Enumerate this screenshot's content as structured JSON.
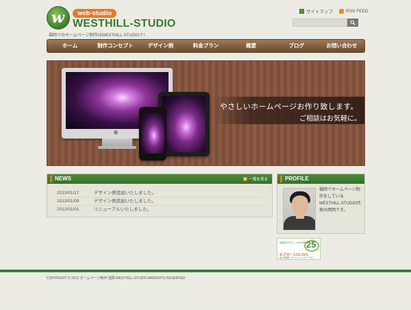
{
  "header": {
    "logo_sub": "web-studio",
    "logo_text": "WESTHILL-STUDIO",
    "logo_mark": "w",
    "tagline": "福岡でのホームページ制作はWESTHILL-STUDIOで！",
    "links": {
      "sitemap": "サイトマップ",
      "rss": "RSS FEED"
    },
    "search": {
      "placeholder": "",
      "button_icon": "search-icon"
    }
  },
  "nav": {
    "items": [
      {
        "label": "ホーム"
      },
      {
        "label": "制作コンセプト"
      },
      {
        "label": "デザイン例"
      },
      {
        "label": "料金プラン"
      },
      {
        "label": "概要"
      },
      {
        "label": "ブログ"
      },
      {
        "label": "お問い合わせ"
      }
    ]
  },
  "hero": {
    "line1": "やさしいホームページお作り致します。",
    "line2": "ご相談はお気軽に。"
  },
  "news": {
    "title": "NEWS",
    "more": "一覧を見る",
    "items": [
      {
        "date": "2013/01/17",
        "text": "デザイン例追加いたしました。"
      },
      {
        "date": "2013/01/09",
        "text": "デザイン例追加いたしました。"
      },
      {
        "date": "2013/01/01",
        "text": "リニューアルいたしました。"
      }
    ]
  },
  "profile": {
    "title": "PROFILE",
    "text": "福岡でホームページ制作をしているWESTHILL-STUDIO代表の西岡です。"
  },
  "banner": {
    "top": "地球を守ろう、きみが使う。",
    "label": "チャレンジ",
    "number": "25",
    "bottom": "めざせ！CO2-25%",
    "sub": "私の地球とチャレンジャーです。"
  },
  "footer": {
    "copyright": "COPYRIGHT © 2012 ホームページ制作 福岡 WESTHILL-STUDIO ARRIGHTS RESERVED"
  },
  "colors": {
    "accent_green": "#3f7b33",
    "accent_orange": "#e47b2a",
    "nav_brown": "#82603e"
  }
}
